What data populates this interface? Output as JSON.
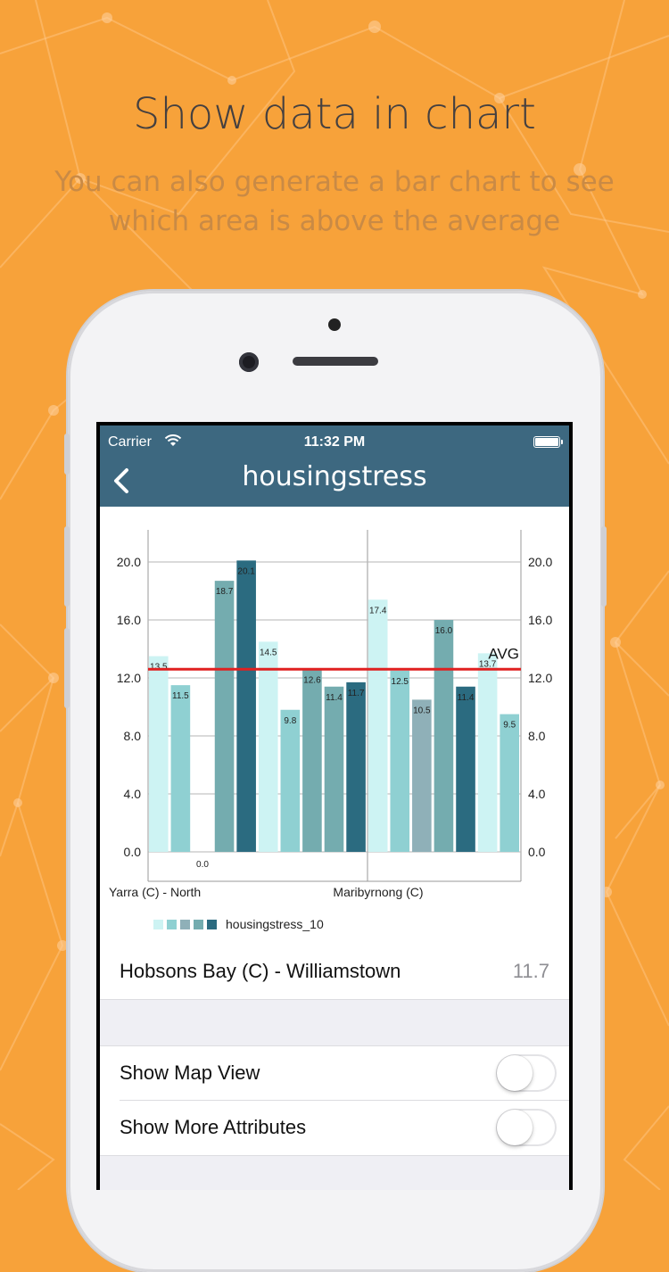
{
  "promo": {
    "headline": "Show data in chart",
    "subline": "You can also generate a bar chart to see which area is above the average"
  },
  "status_bar": {
    "carrier": "Carrier",
    "time": "11:32 PM"
  },
  "nav": {
    "title": "housingstress",
    "back_icon": "chevron-left-icon"
  },
  "chart_data": {
    "type": "bar",
    "values": [
      13.5,
      11.5,
      0.0,
      18.7,
      20.1,
      14.5,
      9.8,
      12.6,
      11.4,
      11.7,
      17.4,
      12.5,
      10.5,
      16.0,
      11.4,
      13.7,
      9.5
    ],
    "value_labels": [
      "13.5",
      "11.5",
      "0.0",
      "18.7",
      "20.1",
      "14.5",
      "9.8",
      "12.6",
      "11.4",
      "11.7",
      "17.4",
      "12.5",
      "10.5",
      "16.0",
      "11.4",
      "13.7",
      "9.5"
    ],
    "bar_colors": [
      "#cdf3f3",
      "#8fd0d2",
      "#8fd0d2",
      "#74acaf",
      "#2b6b80",
      "#cdf3f3",
      "#8fd0d2",
      "#74acaf",
      "#74acaf",
      "#2b6b80",
      "#cdf3f3",
      "#8fd0d2",
      "#8fb0b8",
      "#74acaf",
      "#2b6b80",
      "#cdf3f3",
      "#8fd0d2"
    ],
    "y_ticks": [
      "0.0",
      "4.0",
      "8.0",
      "12.0",
      "16.0",
      "20.0"
    ],
    "ylim": [
      0,
      22
    ],
    "x_tick_labels": [
      "Yarra (C) - North",
      "Maribyrnong (C)"
    ],
    "average": 12.6,
    "average_label": "AVG",
    "average_color": "#e02020",
    "legend": {
      "label": "housingstress_10",
      "swatches": [
        "#cdf3f3",
        "#8fd0d2",
        "#8fb0b8",
        "#74acaf",
        "#2b6b80"
      ]
    },
    "grid": true
  },
  "detail": {
    "label": "Hobsons Bay (C) - Williamstown",
    "value": "11.7"
  },
  "settings": [
    {
      "label": "Show Map View",
      "on": false
    },
    {
      "label": "Show More Attributes",
      "on": false
    }
  ]
}
